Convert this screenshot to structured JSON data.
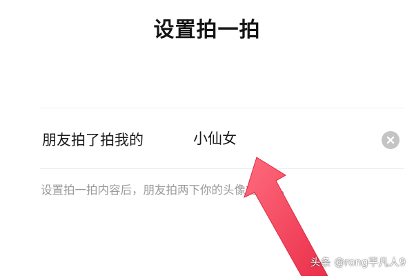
{
  "header": {
    "title": "设置拍一拍"
  },
  "pat_field": {
    "prefix_label": "朋友拍了拍我的",
    "value": "小仙女",
    "clear_icon": "clear-circle-icon"
  },
  "hint": {
    "text": "设置拍一拍内容后，朋友拍两下你的头像将出现。"
  },
  "annotation": {
    "arrow_color": "#f3455f"
  },
  "watermark": {
    "text": "头条 @rong平凡人9"
  }
}
